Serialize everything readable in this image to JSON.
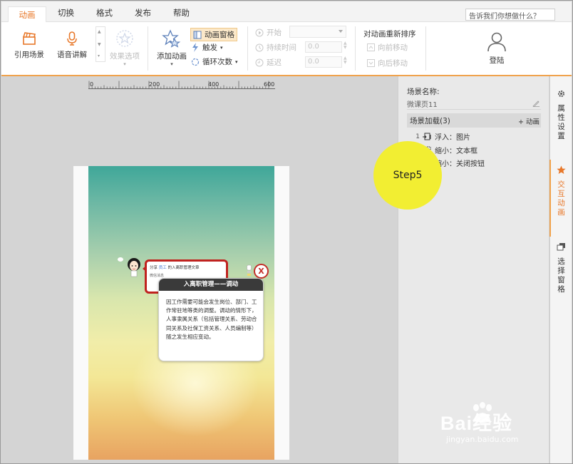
{
  "menubar": {
    "tabs": [
      "动画",
      "切换",
      "格式",
      "发布",
      "帮助"
    ],
    "active_tab": "动画",
    "search_placeholder": "告诉我们你想做什么？"
  },
  "ribbon": {
    "cite_scene": "引用场景",
    "voice": "语音讲解",
    "effect_options": "效果选项",
    "add_animation": "添加动画",
    "animation_pane": "动画窗格",
    "trigger": "触发",
    "loop_count": "循环次数",
    "start": "开始",
    "duration": "持续时间",
    "delay": "延迟",
    "duration_value": "0.0",
    "delay_value": "0.0",
    "reorder_title": "对动画重新排序",
    "move_earlier": "向前移动",
    "move_later": "向后移动",
    "login": "登陆"
  },
  "ruler": {
    "ticks": [
      "0",
      "200",
      "400",
      "600"
    ]
  },
  "phone": {
    "share_prefix": "分享",
    "share_user": "员工",
    "share_suffix": "的入离职管理文章",
    "share_sub": "微信消息",
    "close_label": "X",
    "info_title": "入离职管理——调动",
    "info_body": "因工作需要可能会发生岗位、部门、工作常驻地等类的调整。调动的情形下，人事隶属关系（包括管理关系、劳动合同关系及社保工资关系、人员编制等）随之发生相应变动。"
  },
  "panel": {
    "scene_label": "场景名称:",
    "scene_name": "微课页11",
    "section_title": "场景加载(3)",
    "add_anim": "+ 动画",
    "items": [
      {
        "index": "1",
        "effect": "浮入：图片"
      },
      {
        "index": "",
        "effect": "缩小：文本框"
      },
      {
        "index": "",
        "effect": "缩小：关闭按钮"
      }
    ]
  },
  "sidetabs": {
    "properties": "属性设置",
    "interactive": "交互动画",
    "selection": "选择窗格"
  },
  "overlay": {
    "step": "Step5",
    "watermark": "Bai经验",
    "watermark_url": "jingyan.baidu.com"
  },
  "colors": {
    "accent": "#e8782a",
    "accent_bar": "#f0a24c",
    "step_yellow": "#f2ee32",
    "close_red": "#c4302b"
  }
}
